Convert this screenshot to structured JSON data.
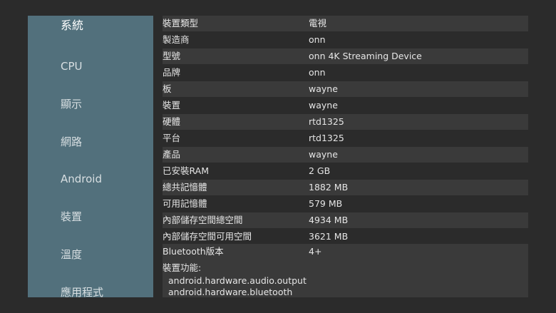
{
  "sidebar": {
    "items": [
      {
        "label": "系統"
      },
      {
        "label": "CPU"
      },
      {
        "label": "顯示"
      },
      {
        "label": "網路"
      },
      {
        "label": "Android"
      },
      {
        "label": "裝置"
      },
      {
        "label": "溫度"
      },
      {
        "label": "應用程式"
      }
    ]
  },
  "system_info": {
    "rows": [
      {
        "label": "裝置類型",
        "value": "電視"
      },
      {
        "label": "製造商",
        "value": "onn"
      },
      {
        "label": "型號",
        "value": "onn 4K Streaming Device"
      },
      {
        "label": "品牌",
        "value": "onn"
      },
      {
        "label": "板",
        "value": "wayne"
      },
      {
        "label": "裝置",
        "value": "wayne"
      },
      {
        "label": "硬體",
        "value": "rtd1325"
      },
      {
        "label": "平台",
        "value": "rtd1325"
      },
      {
        "label": "產品",
        "value": "wayne"
      },
      {
        "label": "已安裝RAM",
        "value": "2 GB"
      },
      {
        "label": "總共記憶體",
        "value": "1882 MB"
      },
      {
        "label": "可用記憶體",
        "value": "579 MB"
      },
      {
        "label": "內部儲存空間總空間",
        "value": "4934 MB"
      },
      {
        "label": "內部儲存空間可用空間",
        "value": "3621 MB"
      },
      {
        "label": "Bluetooth版本",
        "value": "4+"
      }
    ],
    "features": {
      "label": "裝置功能:",
      "items": [
        "android.hardware.audio.output",
        "android.hardware.bluetooth"
      ]
    }
  }
}
